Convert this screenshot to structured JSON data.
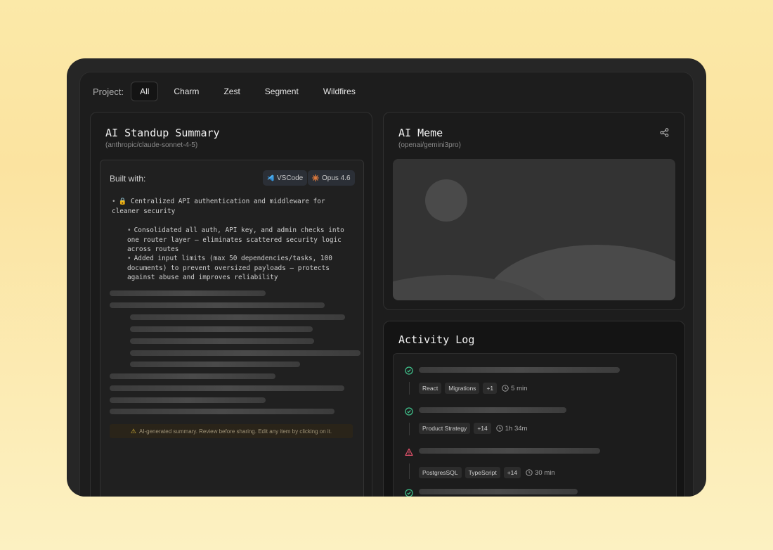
{
  "filters": {
    "label": "Project:",
    "items": [
      "All",
      "Charm",
      "Zest",
      "Segment",
      "Wildfires"
    ],
    "active": "All"
  },
  "standup": {
    "title": "AI Standup Summary",
    "model": "(anthropic/claude-sonnet-4-5)",
    "built_with_label": "Built with:",
    "tools": [
      "VSCode",
      "Opus 4.6"
    ],
    "main_bullet": "Centralized API authentication and middleware for cleaner security",
    "sub_bullets": [
      "Consolidated all auth, API key, and admin checks into one router layer — eliminates scattered security logic across routes",
      "Added input limits (max 50 dependencies/tasks, 100 documents) to prevent oversized payloads — protects against abuse and improves reliability"
    ],
    "warning": "AI-generated summary. Review before sharing. Edit any item by clicking on it."
  },
  "meme": {
    "title": "AI Meme",
    "model": "(openai/gemini3pro)",
    "share_icon": "share-icon"
  },
  "activity": {
    "title": "Activity Log",
    "entries": [
      {
        "status": "success",
        "tags": [
          "React",
          "Migrations",
          "+1"
        ],
        "time": "5 min"
      },
      {
        "status": "success",
        "tags": [
          "Product Strategy",
          "+14"
        ],
        "time": "1h 34m"
      },
      {
        "status": "warning",
        "tags": [
          "PostgresSQL",
          "TypeScript",
          "+14"
        ],
        "time": "30 min"
      },
      {
        "status": "success",
        "tags": [],
        "time": ""
      }
    ]
  },
  "colors": {
    "success": "#3fbf8a",
    "warning": "#e0506a",
    "accent_bg": "#fbe9a8"
  }
}
